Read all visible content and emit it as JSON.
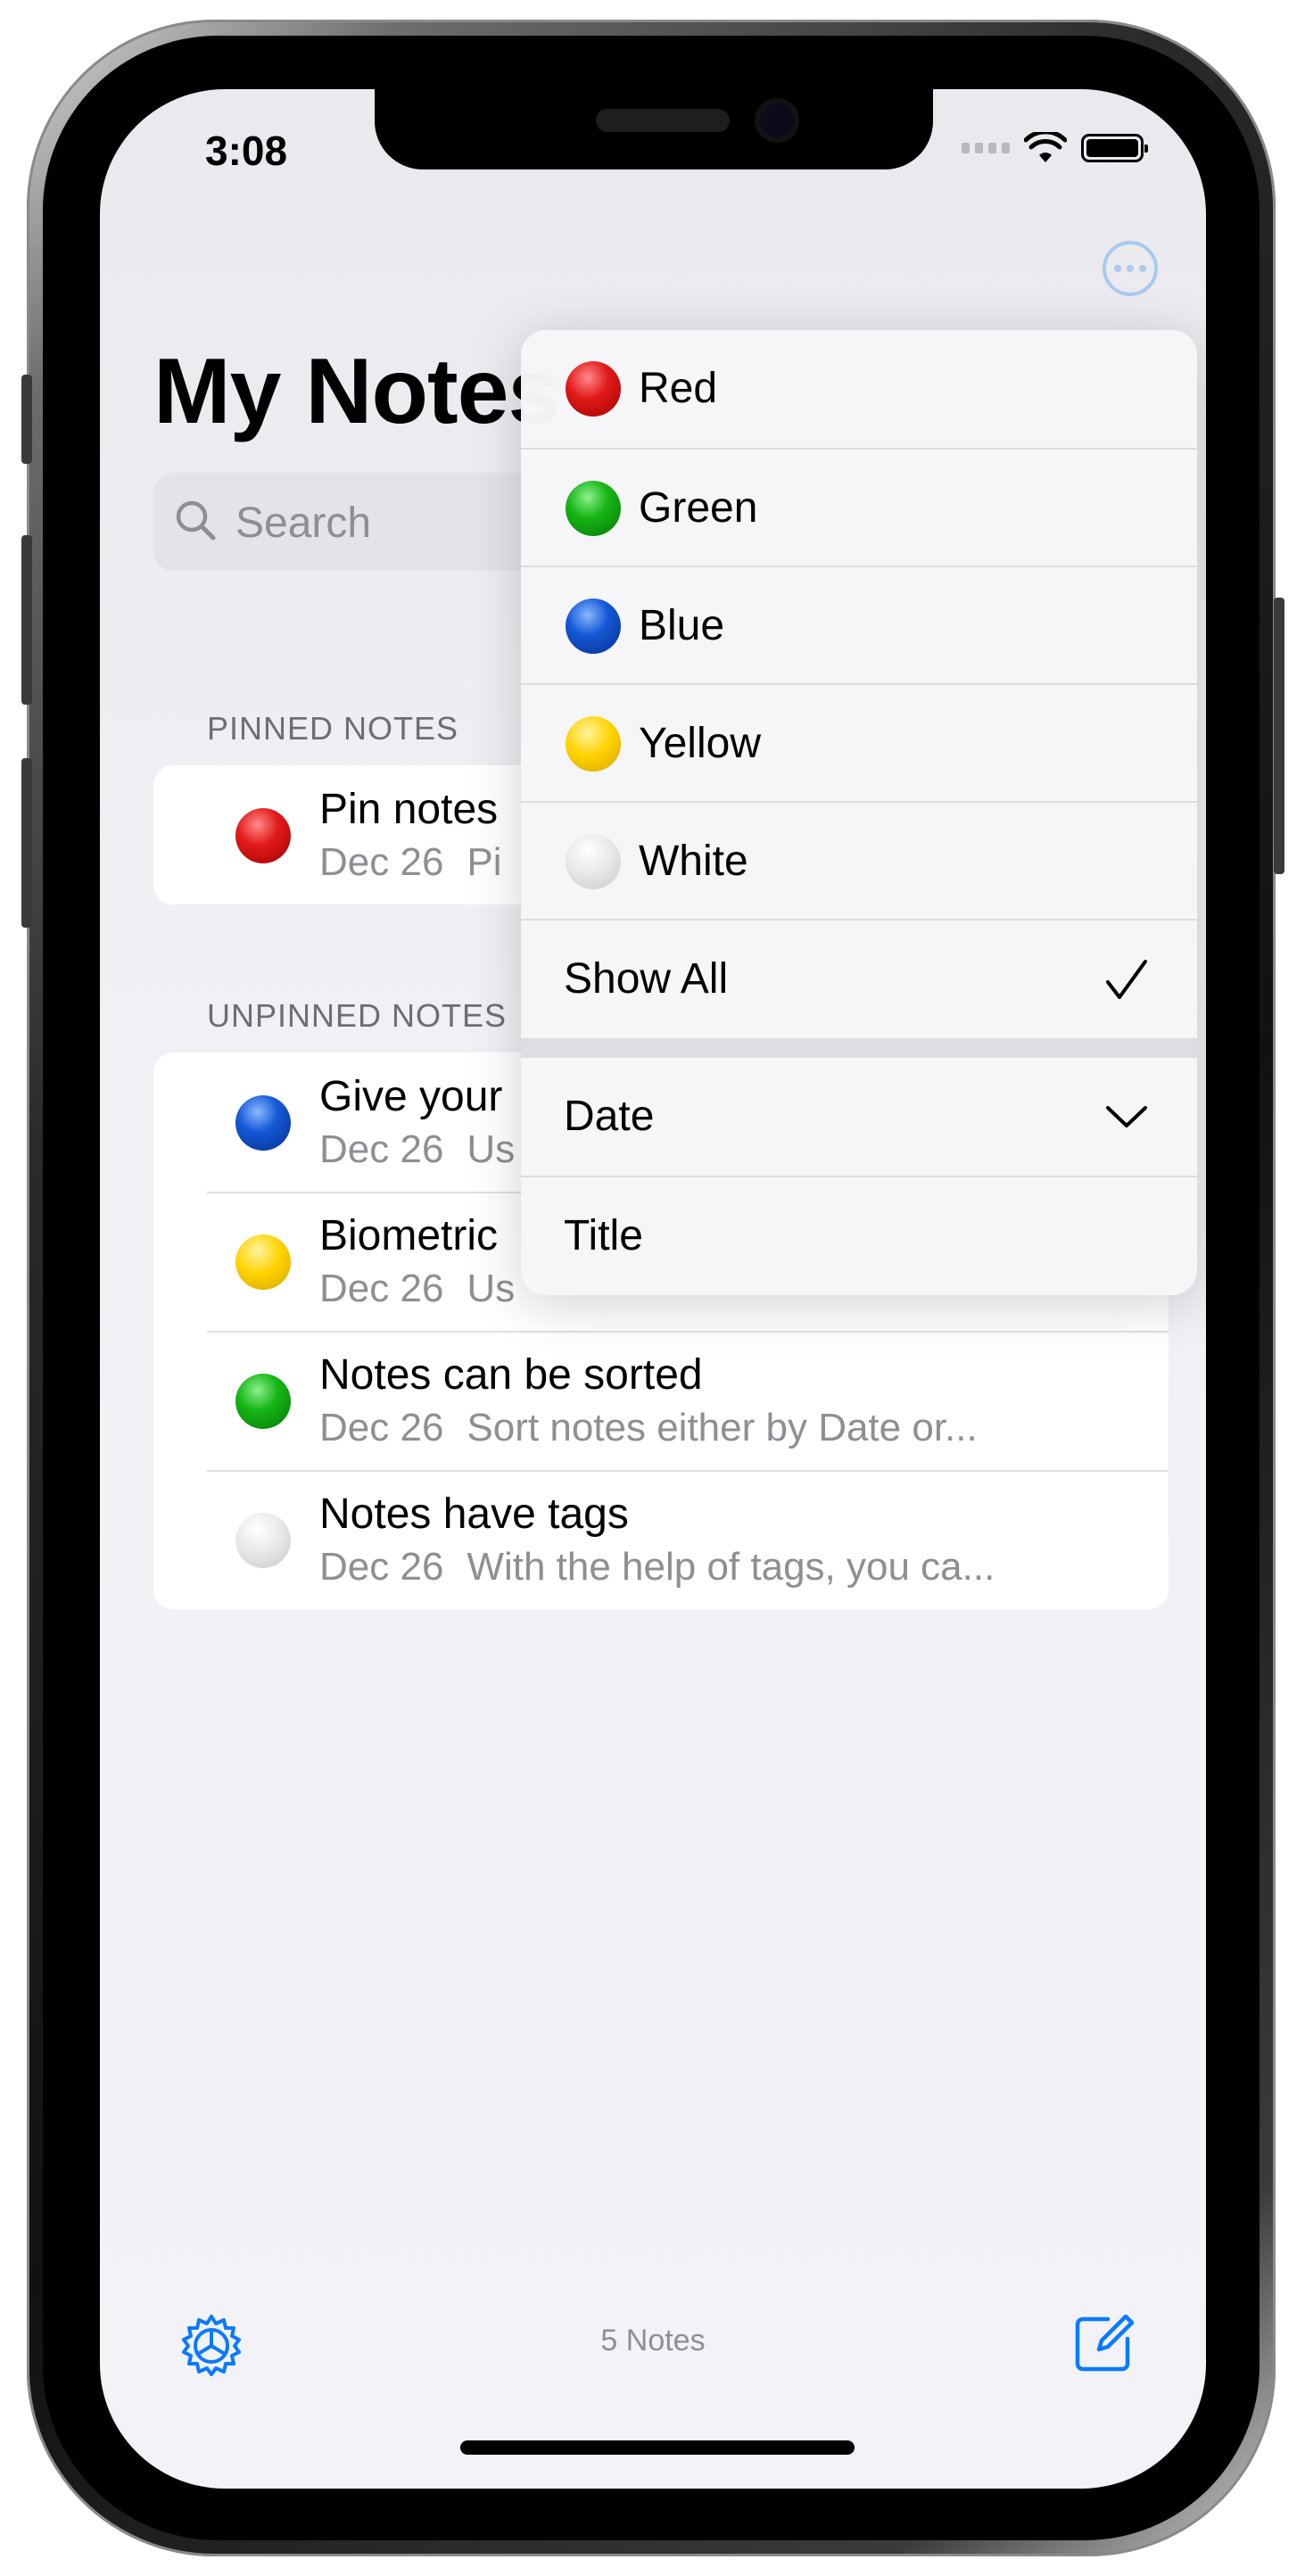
{
  "status": {
    "time": "3:08"
  },
  "header": {
    "title": "My Notes"
  },
  "search": {
    "placeholder": "Search"
  },
  "sections": {
    "pinned": {
      "label": "PINNED NOTES",
      "items": [
        {
          "title": "Pin notes",
          "date": "Dec 26",
          "preview": "Pi",
          "color": "red"
        }
      ]
    },
    "unpinned": {
      "label": "UNPINNED NOTES",
      "items": [
        {
          "title": "Give your",
          "date": "Dec 26",
          "preview": "Us",
          "color": "blue"
        },
        {
          "title": "Biometric",
          "date": "Dec 26",
          "preview": "Us",
          "color": "yellow"
        },
        {
          "title": "Notes can be sorted",
          "date": "Dec 26",
          "preview": "Sort notes either by Date or...",
          "color": "green"
        },
        {
          "title": "Notes have tags",
          "date": "Dec 26",
          "preview": "With the help of tags, you ca...",
          "color": "white"
        }
      ]
    }
  },
  "menu": {
    "colors": [
      {
        "label": "Red",
        "color": "red"
      },
      {
        "label": "Green",
        "color": "green"
      },
      {
        "label": "Blue",
        "color": "blue"
      },
      {
        "label": "Yellow",
        "color": "yellow"
      },
      {
        "label": "White",
        "color": "white"
      }
    ],
    "show_all": {
      "label": "Show All",
      "checked": true
    },
    "sort": [
      {
        "label": "Date",
        "selected": true
      },
      {
        "label": "Title",
        "selected": false
      }
    ]
  },
  "toolbar": {
    "count_label": "5 Notes"
  },
  "colors": {
    "accent": "#0a7aff",
    "red": "#e21b1b",
    "green": "#16b516",
    "blue": "#1458d6",
    "yellow": "#ffd300",
    "white": "#e6e6e6"
  }
}
